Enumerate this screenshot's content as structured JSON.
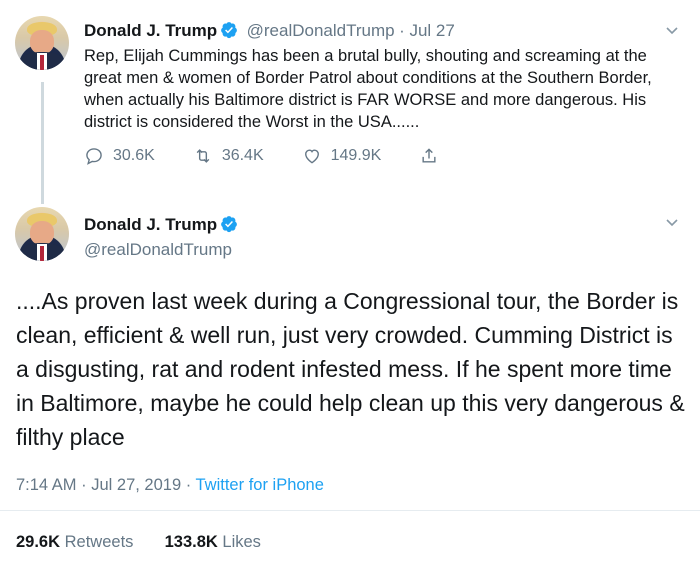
{
  "colors": {
    "accent": "#1da1f2",
    "verified": "#1da1f2",
    "muted": "#657786",
    "text": "#14171a"
  },
  "tweet1": {
    "name": "Donald J. Trump",
    "handle": "@realDonaldTrump",
    "date": "Jul 27",
    "text": "Rep, Elijah Cummings has been a brutal bully, shouting and screaming at the great men & women of Border Patrol about conditions at the Southern Border, when actually his Baltimore district is FAR WORSE and more dangerous. His district is considered the Worst in the USA......",
    "replies": "30.6K",
    "retweets": "36.4K",
    "likes": "149.9K",
    "icons": {
      "reply": "reply-icon",
      "retweet": "retweet-icon",
      "like": "heart-icon",
      "share": "share-icon",
      "menu": "chevron-down-icon"
    }
  },
  "tweet2": {
    "name": "Donald J. Trump",
    "handle": "@realDonaldTrump",
    "text": "....As proven last week during a Congressional tour, the Border is clean, efficient & well run, just very crowded. Cumming District is a disgusting, rat and rodent infested mess. If he spent more time in Baltimore, maybe he could help clean up this very dangerous & filthy place",
    "time": "7:14 AM",
    "date": "Jul 27, 2019",
    "source": "Twitter for iPhone",
    "retweets_count": "29.6K",
    "retweets_label": "Retweets",
    "likes_count": "133.8K",
    "likes_label": "Likes"
  }
}
